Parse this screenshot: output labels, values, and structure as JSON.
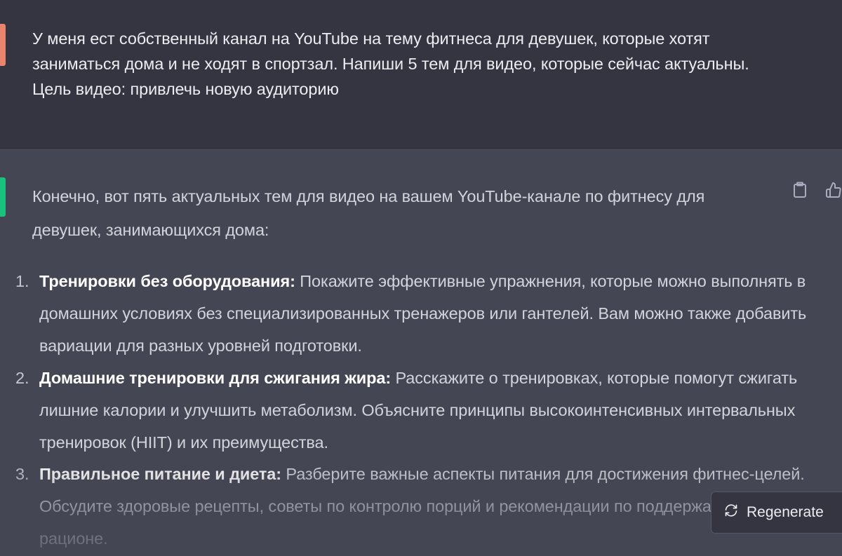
{
  "user_message": {
    "text": "У меня ест собственный канал на YouTube  на тему фитнеса для девушек, которые хотят заниматься дома и не ходят в спортзал. Напиши 5 тем для видео, которые сейчас актуальны. Цель видео: привлечь новую аудиторию"
  },
  "assistant_message": {
    "intro": "Конечно, вот пять актуальных тем для видео на вашем YouTube-канале по фитнесу для девушек, занимающихся дома:",
    "topics": [
      {
        "number": "1.",
        "title": "Тренировки без оборудования:",
        "body": " Покажите эффективные упражнения, которые можно выполнять в домашних условиях без специализированных тренажеров или гантелей. Вам можно также добавить вариации для разных уровней подготовки."
      },
      {
        "number": "2.",
        "title": "Домашние тренировки для сжигания жира:",
        "body": " Расскажите о тренировках, которые помогут сжигать лишние калории и улучшить метаболизм. Объясните принципы высокоинтенсивных интервальных тренировок (HIIT) и их преимущества."
      },
      {
        "number": "3.",
        "title": "Правильное питание и диета:",
        "body": " Разберите важные аспекты питания для достижения фитнес-целей. Обсудите здоровые рецепты, советы по контролю порций и рекомендации по поддержанию баланса в рационе."
      }
    ]
  },
  "actions": {
    "copy_icon": "clipboard-icon",
    "like_icon": "thumbs-up-icon"
  },
  "regenerate": {
    "label": "Regenerate",
    "icon": "refresh-icon"
  },
  "colors": {
    "user_bg": "#343541",
    "assistant_bg": "#444654",
    "user_avatar": "#e9856f",
    "assistant_avatar": "#19c37d",
    "text": "#d1d5db"
  }
}
